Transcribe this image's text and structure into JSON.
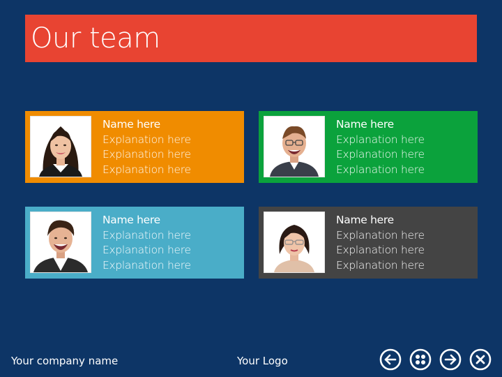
{
  "header": {
    "title": "Our team",
    "color": "#e84432"
  },
  "team": [
    {
      "name": "Name here",
      "lines": [
        "Explanation here",
        "Explanation here",
        "Explanation here"
      ],
      "color": "#f08c00"
    },
    {
      "name": "Name here",
      "lines": [
        "Explanation here",
        "Explanation here",
        "Explanation here"
      ],
      "color": "#0ba23c"
    },
    {
      "name": "Name here",
      "lines": [
        "Explanation here",
        "Explanation here",
        "Explanation here"
      ],
      "color": "#4aadc8"
    },
    {
      "name": "Name here",
      "lines": [
        "Explanation here",
        "Explanation here",
        "Explanation here"
      ],
      "color": "#444444"
    }
  ],
  "footer": {
    "company": "Your company name",
    "logo": "Your Logo"
  },
  "nav": {
    "buttons": [
      {
        "icon": "arrow-left-icon"
      },
      {
        "icon": "menu-grid-icon"
      },
      {
        "icon": "arrow-right-icon"
      },
      {
        "icon": "close-icon"
      }
    ]
  },
  "colors": {
    "background": "#0d3566"
  }
}
